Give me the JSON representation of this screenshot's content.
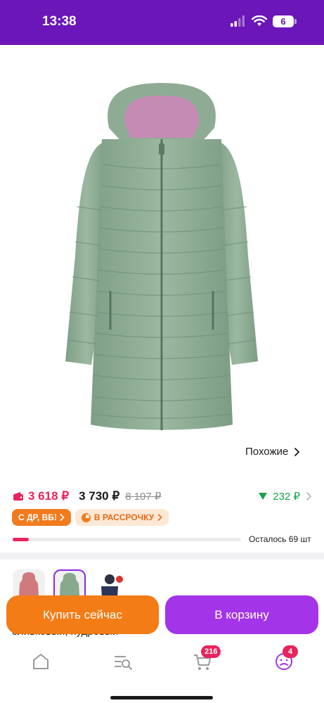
{
  "status_bar": {
    "time": "13:38",
    "battery": "6",
    "background": "#6b16b8"
  },
  "product": {
    "image_icon": "jacket-photo",
    "gallery_count": 4,
    "gallery_active": 1,
    "similar_label": "Похожие"
  },
  "price": {
    "wallet_price": "3 618 ₽",
    "price": "3 730 ₽",
    "old_price": "8 107 ₽",
    "bonus": "232 ₽"
  },
  "badges": {
    "birthday": "С ДР, ВБ!",
    "installment": "В РАССРОЧКУ"
  },
  "stock": {
    "label": "Осталось 69 шт",
    "fill_fraction": 0.07
  },
  "variants": {
    "colors_text": "оливковый, пудровый"
  },
  "actions": {
    "buy_now": "Купить сейчас",
    "add_to_cart": "В корзину"
  },
  "tabbar": {
    "cart_count": "216",
    "profile_count": "4"
  },
  "colors": {
    "accent": "#a434e8",
    "buy": "#f47c16",
    "sale": "#e8245c",
    "bonus": "#1aa34a"
  }
}
